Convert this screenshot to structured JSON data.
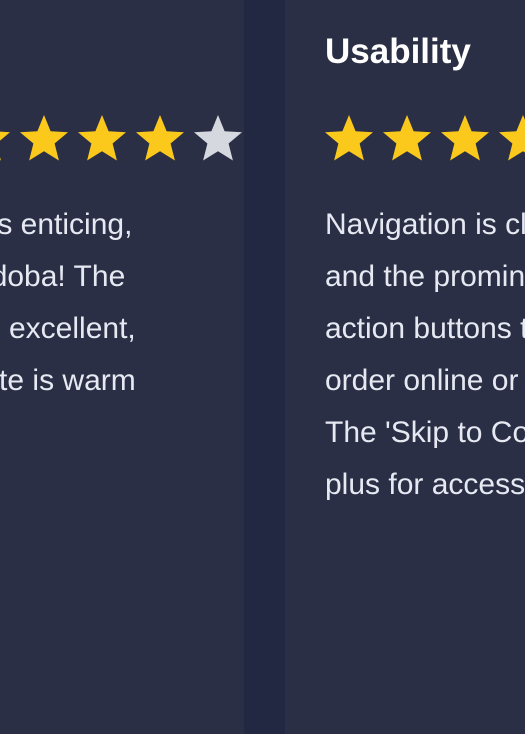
{
  "colors": {
    "page_background": "#222841",
    "card_background": "#2a2f45",
    "star_filled": "#fbc91b",
    "star_empty": "#d6d8df",
    "text": "#e7e9f2",
    "heading": "#ffffff"
  },
  "cards": {
    "left": {
      "rating": {
        "value": 4,
        "max": 5
      },
      "body_lines": [
        "lors is enticing,",
        "of Qdoba! The",
        "lity is excellent,",
        "palette is warm"
      ]
    },
    "right": {
      "title": "Usability",
      "rating": {
        "value": 4,
        "max": 5
      },
      "body_lines": [
        "Navigation is clear",
        "and the prominent",
        "action buttons to",
        "order online or",
        "The 'Skip to Content'",
        "plus for accessibility"
      ]
    }
  },
  "icons": {
    "star": "star-icon"
  }
}
